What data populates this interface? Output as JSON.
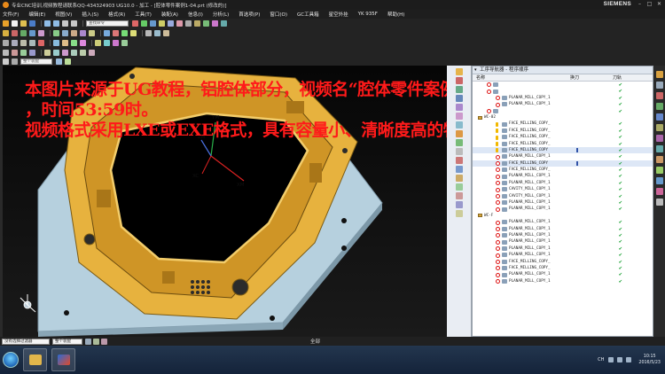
{
  "window": {
    "title": "专业CNC培训,视频教程请联系QQ-434324903 UG10.0 - 加工 - [腔体零件案例1-04.prt  (修改的)]",
    "brand": "SIEMENS"
  },
  "menu": [
    "文件(F)",
    "编辑(E)",
    "视图(V)",
    "插入(S)",
    "格式(R)",
    "工具(T)",
    "装配(A)",
    "信息(I)",
    "分析(L)",
    "首选项(P)",
    "窗口(O)",
    "GC工具箱",
    "星空外挂",
    "YK 935F",
    "帮助(H)"
  ],
  "toolbar": {
    "command_search_placeholder": "查找命令",
    "filter_value": "整个装配"
  },
  "watermark": [
    "本图片来源于UG教程，铝腔体部分，视频名“腔体零件案例1-04-3”",
    "，时间53:59时。",
    "视频格式采用LXE或EXE格式，具有容量小、清晰度高的特点"
  ],
  "viewport": {
    "axis_labels": [
      "YM",
      "ZM",
      "XC",
      "XM"
    ]
  },
  "navigator": {
    "title": "工序导航器 - 程序顺序",
    "columns": [
      "名称",
      "换刀",
      "刀轨"
    ],
    "rows": [
      {
        "label": "",
        "icon": "no",
        "indent": 1,
        "check": true,
        "bar": false
      },
      {
        "label": "",
        "icon": "no",
        "indent": 1,
        "check": true,
        "bar": false
      },
      {
        "label": "PLANAR_MILL_COPY_1",
        "icon": "no",
        "indent": 2,
        "check": true,
        "bar": false
      },
      {
        "label": "PLANAR_MILL_COPY_1",
        "icon": "no",
        "indent": 2,
        "check": true,
        "bar": false
      },
      {
        "label": "",
        "icon": "no",
        "indent": 1,
        "check": true,
        "bar": false
      },
      {
        "label": "WC-02",
        "icon": "group",
        "indent": 0,
        "check": false,
        "bar": false
      },
      {
        "label": "FACE_MILLING_COPY_",
        "icon": "wrench",
        "indent": 2,
        "check": true,
        "bar": false
      },
      {
        "label": "FACE_MILLING_COPY_",
        "icon": "wrench",
        "indent": 2,
        "check": true,
        "bar": false
      },
      {
        "label": "FACE_MILLING_COPY_",
        "icon": "wrench",
        "indent": 2,
        "check": true,
        "bar": false
      },
      {
        "label": "FACE_MILLING_COPY_",
        "icon": "wrench",
        "indent": 2,
        "check": true,
        "bar": false
      },
      {
        "label": "FACE_MILLING_COPY",
        "icon": "wrench",
        "indent": 2,
        "check": true,
        "bar": true
      },
      {
        "label": "PLANAR_MILL_COPY_1",
        "icon": "no",
        "indent": 2,
        "check": true,
        "bar": false
      },
      {
        "label": "FACE_MILLING_COPY",
        "icon": "no",
        "indent": 2,
        "check": true,
        "bar": true
      },
      {
        "label": "FACE_MILLING_COPY_",
        "icon": "no",
        "indent": 2,
        "check": true,
        "bar": false
      },
      {
        "label": "PLANAR_MILL_COPY_1",
        "icon": "no",
        "indent": 2,
        "check": true,
        "bar": false
      },
      {
        "label": "PLANAR_MILL_COPY_1",
        "icon": "no",
        "indent": 2,
        "check": true,
        "bar": false
      },
      {
        "label": "CAVITY_MILL_COPY_1",
        "icon": "no",
        "indent": 2,
        "check": true,
        "bar": false
      },
      {
        "label": "CAVITY_MILL_COPY_1",
        "icon": "no",
        "indent": 2,
        "check": true,
        "bar": false
      },
      {
        "label": "PLANAR_MILL_COPY_1",
        "icon": "no",
        "indent": 2,
        "check": true,
        "bar": false
      },
      {
        "label": "PLANAR_MILL_COPY_1",
        "icon": "no",
        "indent": 2,
        "check": true,
        "bar": false
      },
      {
        "label": "WC-F",
        "icon": "group",
        "indent": 0,
        "check": false,
        "bar": false
      },
      {
        "label": "PLANAR_MILL_COPY_1",
        "icon": "no",
        "indent": 2,
        "check": true,
        "bar": false
      },
      {
        "label": "PLANAR_MILL_COPY_1",
        "icon": "no",
        "indent": 2,
        "check": true,
        "bar": false
      },
      {
        "label": "PLANAR_MILL_COPY_1",
        "icon": "no",
        "indent": 2,
        "check": true,
        "bar": false
      },
      {
        "label": "PLANAR_MILL_COPY_1",
        "icon": "no",
        "indent": 2,
        "check": true,
        "bar": false
      },
      {
        "label": "PLANAR_MILL_COPY_1",
        "icon": "no",
        "indent": 2,
        "check": true,
        "bar": false
      },
      {
        "label": "PLANAR_MILL_COPY_1",
        "icon": "no",
        "indent": 2,
        "check": true,
        "bar": false
      },
      {
        "label": "FACE_MILLING_COPY_",
        "icon": "no",
        "indent": 2,
        "check": true,
        "bar": false
      },
      {
        "label": "FACE_MILLING_COPY_",
        "icon": "no",
        "indent": 2,
        "check": true,
        "bar": false
      },
      {
        "label": "PLANAR_MILL_COPY_1",
        "icon": "no",
        "indent": 2,
        "check": true,
        "bar": false
      },
      {
        "label": "PLANAR_MILL_COPY_1",
        "icon": "no",
        "indent": 2,
        "check": true,
        "bar": false
      }
    ]
  },
  "statusbar": {
    "selection_filter": "没有选择过滤器",
    "selection_scope": "整个装配",
    "center_text": "全部"
  },
  "taskbar": {
    "ime": "CH",
    "time": "10:15",
    "date": "2016/5/23"
  },
  "colors": {
    "watermark": "#ff1a1a",
    "part_fill": "#e7b23e",
    "base_fill": "#bfd7e3",
    "check": "#0a9a25"
  }
}
